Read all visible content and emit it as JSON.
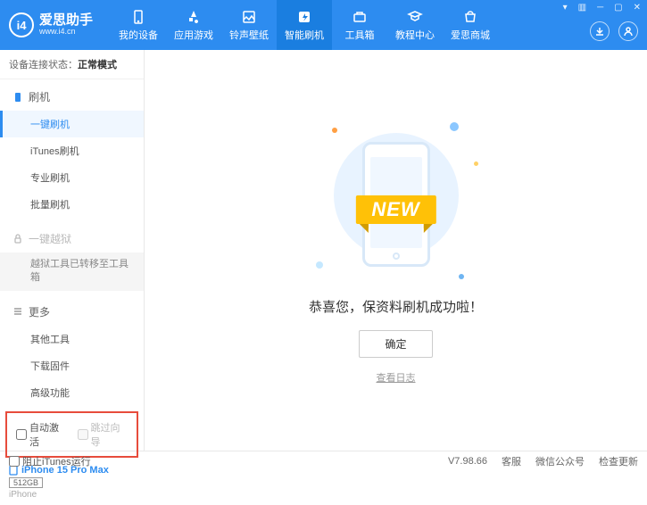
{
  "header": {
    "logo_title": "爱思助手",
    "logo_sub": "www.i4.cn",
    "nav": [
      {
        "label": "我的设备"
      },
      {
        "label": "应用游戏"
      },
      {
        "label": "铃声壁纸"
      },
      {
        "label": "智能刷机"
      },
      {
        "label": "工具箱"
      },
      {
        "label": "教程中心"
      },
      {
        "label": "爱思商城"
      }
    ]
  },
  "status": {
    "label": "设备连接状态：",
    "value": "正常模式"
  },
  "sidebar": {
    "flash_head": "刷机",
    "items_flash": [
      "一键刷机",
      "iTunes刷机",
      "专业刷机",
      "批量刷机"
    ],
    "jailbreak_head": "一键越狱",
    "jailbreak_note": "越狱工具已转移至工具箱",
    "more_head": "更多",
    "items_more": [
      "其他工具",
      "下载固件",
      "高级功能"
    ],
    "checkbox1": "自动激活",
    "checkbox2": "跳过向导"
  },
  "device": {
    "name": "iPhone 15 Pro Max",
    "storage": "512GB",
    "type": "iPhone"
  },
  "main": {
    "ribbon": "NEW",
    "success": "恭喜您，保资料刷机成功啦！",
    "confirm": "确定",
    "log": "查看日志"
  },
  "footer": {
    "block_itunes": "阻止iTunes运行",
    "version": "V7.98.66",
    "links": [
      "客服",
      "微信公众号",
      "检查更新"
    ]
  }
}
